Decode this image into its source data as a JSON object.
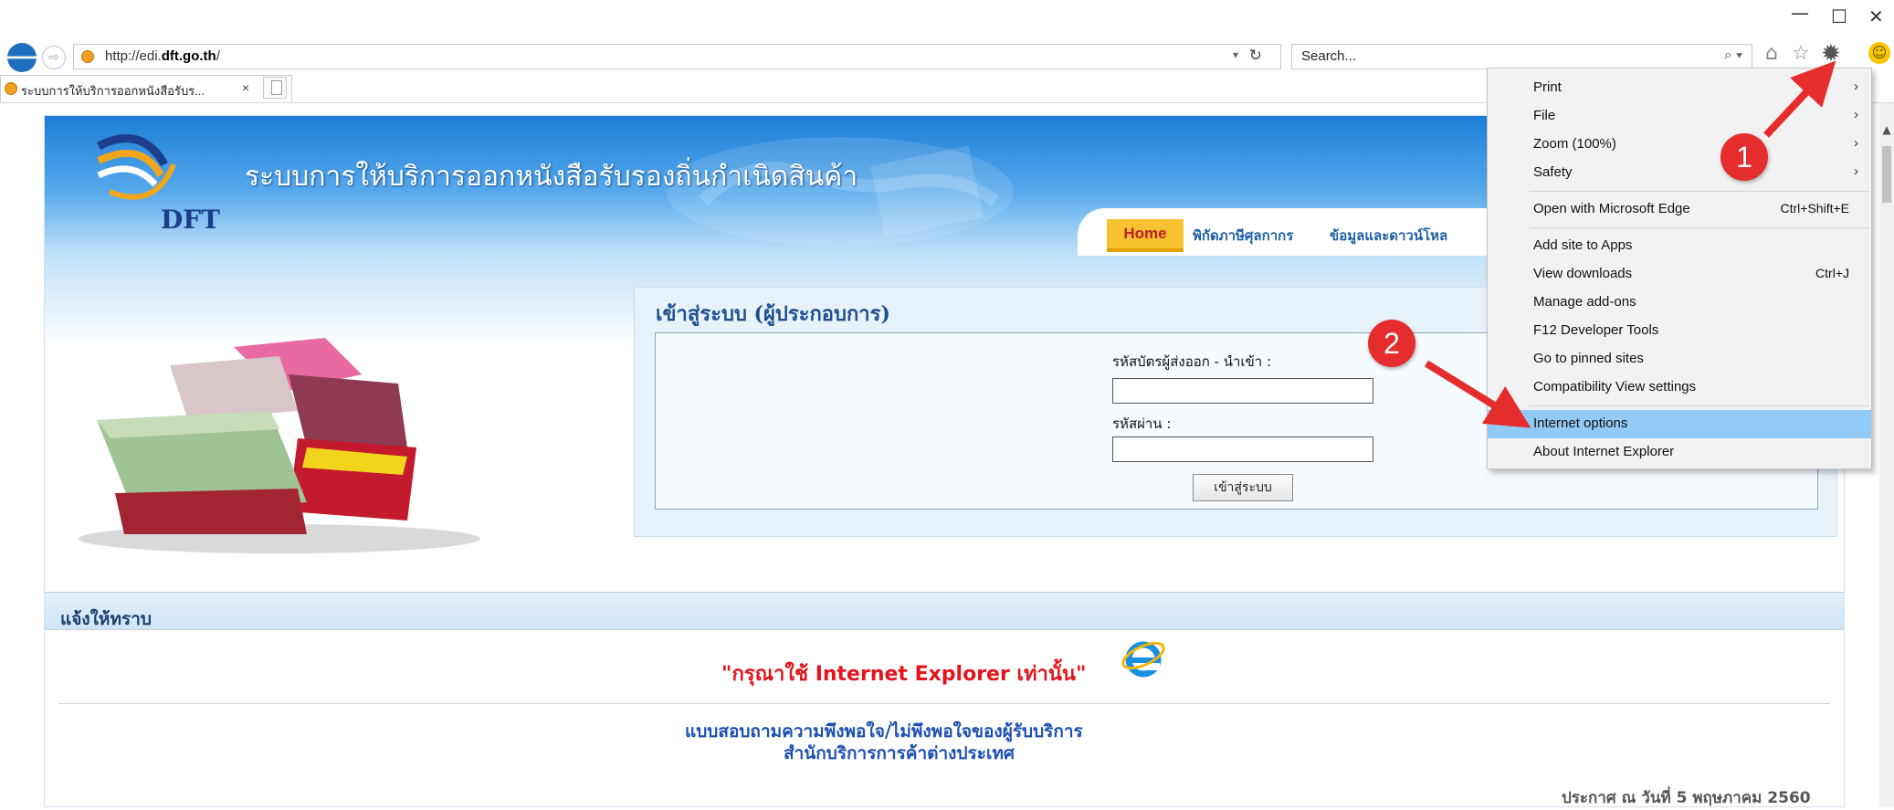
{
  "browser": {
    "address_url_prefix": "http://edi.",
    "address_url_domain": "dft.go.th",
    "address_url_suffix": "/",
    "search_placeholder": "Search...",
    "tab_title": "ระบบการให้บริการออกหนังสือรับร...",
    "tab_close": "×",
    "back": "🡐",
    "forward": "⇨",
    "refresh": "↻",
    "dropdown": "▾",
    "search_glyph": "⌕ ▾",
    "home_glyph": "⌂",
    "star_glyph": "☆",
    "tools_glyph": "✹",
    "smiley_glyph": "☺",
    "minimize": "—",
    "maximize": "☐",
    "close": "✕"
  },
  "site": {
    "logo_text": "DFT",
    "title": "ระบบการให้บริการออกหนังสือรับรองถิ่นกำเนิดสินค้า",
    "nav": {
      "home": "Home",
      "customs": "พิกัดภาษีศุลกากร",
      "info": "ข้อมูลและดาวน์โหล"
    }
  },
  "login": {
    "title": "เข้าสู่ระบบ (ผู้ประกอบการ)",
    "id_label": "รหัสบัตรผู้ส่งออก - นำเข้า :",
    "id_value": "",
    "password_label": "รหัสผ่าน :",
    "password_value": "",
    "submit": "เข้าสู่ระบบ"
  },
  "notice": {
    "heading": "แจ้งให้ทราบ",
    "ie_notice": "\"กรุณาใช้ Internet Explorer เท่านั้น\"",
    "survey_line1": "แบบสอบถามความพึงพอใจ/ไม่พึงพอใจของผู้รับบริการ",
    "survey_line2": "สำนักบริการการค้าต่างประเทศ",
    "date": "ประกาศ ณ วันที่ 5 พฤษภาคม 2560"
  },
  "tools_menu": {
    "items": [
      {
        "label": "Print",
        "shortcut": "",
        "submenu": true
      },
      {
        "label": "File",
        "shortcut": "",
        "submenu": true
      },
      {
        "label": "Zoom (100%)",
        "shortcut": "",
        "submenu": true
      },
      {
        "label": "Safety",
        "shortcut": "",
        "submenu": true
      },
      {
        "label": "Open with Microsoft Edge",
        "shortcut": "Ctrl+Shift+E",
        "submenu": false
      },
      {
        "label": "Add site to Apps",
        "shortcut": "",
        "submenu": false
      },
      {
        "label": "View downloads",
        "shortcut": "Ctrl+J",
        "submenu": false
      },
      {
        "label": "Manage add-ons",
        "shortcut": "",
        "submenu": false
      },
      {
        "label": "F12 Developer Tools",
        "shortcut": "",
        "submenu": false
      },
      {
        "label": "Go to pinned sites",
        "shortcut": "",
        "submenu": false
      },
      {
        "label": "Compatibility View settings",
        "shortcut": "",
        "submenu": false
      },
      {
        "label": "Internet options",
        "shortcut": "",
        "submenu": false,
        "highlighted": true
      },
      {
        "label": "About Internet Explorer",
        "shortcut": "",
        "submenu": false
      }
    ],
    "chevron": "›"
  },
  "annotations": {
    "badge_1": "1",
    "badge_2": "2",
    "color": "#e52d2d"
  },
  "colors": {
    "banner": "#1e7ed6",
    "menu_highlight": "#91c9f7",
    "notice_red": "#e3141c",
    "survey_blue": "#1e50b4"
  }
}
